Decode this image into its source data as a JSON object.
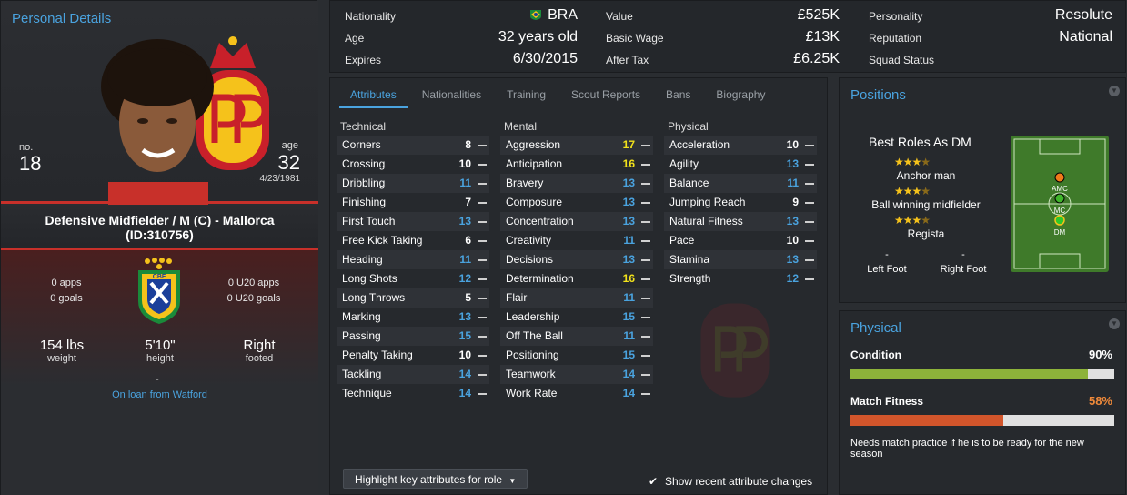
{
  "left": {
    "title": "Personal Details",
    "number_label": "no.",
    "number": "18",
    "age_label": "age",
    "age": "32",
    "dob": "4/23/1981",
    "role_line1": "Defensive Midfielder / M (C) - Mallorca",
    "role_line2": "(ID:310756)",
    "apps": "0 apps",
    "goals": "0 goals",
    "u20_apps": "0 U20 apps",
    "u20_goals": "0 U20 goals",
    "weight": "154 lbs",
    "weight_label": "weight",
    "height": "5'10\"",
    "height_label": "height",
    "foot": "Right",
    "foot_label": "footed",
    "dash": "-",
    "loan": "On loan from Watford",
    "badge_text": "CBF"
  },
  "topbar": {
    "nationality_label": "Nationality",
    "nationality": "BRA",
    "age_label": "Age",
    "age": "32 years old",
    "expires_label": "Expires",
    "expires": "6/30/2015",
    "value_label": "Value",
    "value": "£525K",
    "wage_label": "Basic Wage",
    "wage": "£13K",
    "aftertax_label": "After Tax",
    "aftertax": "£6.25K",
    "personality_label": "Personality",
    "personality": "Resolute",
    "reputation_label": "Reputation",
    "reputation": "National",
    "squad_label": "Squad Status"
  },
  "tabs": [
    "Attributes",
    "Nationalities",
    "Training",
    "Scout Reports",
    "Bans",
    "Biography"
  ],
  "attributes": {
    "technical_title": "Technical",
    "mental_title": "Mental",
    "physical_title": "Physical",
    "technical": [
      {
        "name": "Corners",
        "value": "8",
        "c": "w"
      },
      {
        "name": "Crossing",
        "value": "10",
        "c": "w"
      },
      {
        "name": "Dribbling",
        "value": "11",
        "c": "b"
      },
      {
        "name": "Finishing",
        "value": "7",
        "c": "w"
      },
      {
        "name": "First Touch",
        "value": "13",
        "c": "b"
      },
      {
        "name": "Free Kick Taking",
        "value": "6",
        "c": "w"
      },
      {
        "name": "Heading",
        "value": "11",
        "c": "b"
      },
      {
        "name": "Long Shots",
        "value": "12",
        "c": "b"
      },
      {
        "name": "Long Throws",
        "value": "5",
        "c": "w"
      },
      {
        "name": "Marking",
        "value": "13",
        "c": "b"
      },
      {
        "name": "Passing",
        "value": "15",
        "c": "b"
      },
      {
        "name": "Penalty Taking",
        "value": "10",
        "c": "w"
      },
      {
        "name": "Tackling",
        "value": "14",
        "c": "b"
      },
      {
        "name": "Technique",
        "value": "14",
        "c": "b"
      }
    ],
    "mental": [
      {
        "name": "Aggression",
        "value": "17",
        "c": "y"
      },
      {
        "name": "Anticipation",
        "value": "16",
        "c": "y"
      },
      {
        "name": "Bravery",
        "value": "13",
        "c": "b"
      },
      {
        "name": "Composure",
        "value": "13",
        "c": "b"
      },
      {
        "name": "Concentration",
        "value": "13",
        "c": "b"
      },
      {
        "name": "Creativity",
        "value": "11",
        "c": "b"
      },
      {
        "name": "Decisions",
        "value": "13",
        "c": "b"
      },
      {
        "name": "Determination",
        "value": "16",
        "c": "y"
      },
      {
        "name": "Flair",
        "value": "11",
        "c": "b"
      },
      {
        "name": "Leadership",
        "value": "15",
        "c": "b"
      },
      {
        "name": "Off The Ball",
        "value": "11",
        "c": "b"
      },
      {
        "name": "Positioning",
        "value": "15",
        "c": "b"
      },
      {
        "name": "Teamwork",
        "value": "14",
        "c": "b"
      },
      {
        "name": "Work Rate",
        "value": "14",
        "c": "b"
      }
    ],
    "physical": [
      {
        "name": "Acceleration",
        "value": "10",
        "c": "w"
      },
      {
        "name": "Agility",
        "value": "13",
        "c": "b"
      },
      {
        "name": "Balance",
        "value": "11",
        "c": "b"
      },
      {
        "name": "Jumping Reach",
        "value": "9",
        "c": "w"
      },
      {
        "name": "Natural Fitness",
        "value": "13",
        "c": "b"
      },
      {
        "name": "Pace",
        "value": "10",
        "c": "w"
      },
      {
        "name": "Stamina",
        "value": "13",
        "c": "b"
      },
      {
        "name": "Strength",
        "value": "12",
        "c": "b"
      }
    ],
    "highlight_button": "Highlight key attributes for role",
    "recent_changes": "Show recent attribute changes"
  },
  "positions": {
    "title": "Positions",
    "best_roles": "Best Roles As DM",
    "roles": [
      {
        "name": "Anchor man",
        "stars": 3.5
      },
      {
        "name": "Ball winning midfielder",
        "stars": 3.5
      },
      {
        "name": "Regista",
        "stars": 3.5
      }
    ],
    "left_foot_value": "-",
    "left_foot": "Left Foot",
    "right_foot_value": "-",
    "right_foot": "Right Foot",
    "pitch_markers": [
      "AMC",
      "MC",
      "DM"
    ]
  },
  "physical": {
    "title": "Physical",
    "condition_label": "Condition",
    "condition": "90%",
    "condition_level": 0.9,
    "fitness_label": "Match Fitness",
    "fitness": "58%",
    "fitness_level": 0.58,
    "note": "Needs match practice if he is to be ready for the new season"
  },
  "colors": {
    "accent": "#4aa3df",
    "highlight": "#f2e21b",
    "condition_bar": "#8db33a",
    "fitness_bar": "#d2552b",
    "fitness_text": "#f08a3a",
    "red": "#c8302a"
  }
}
